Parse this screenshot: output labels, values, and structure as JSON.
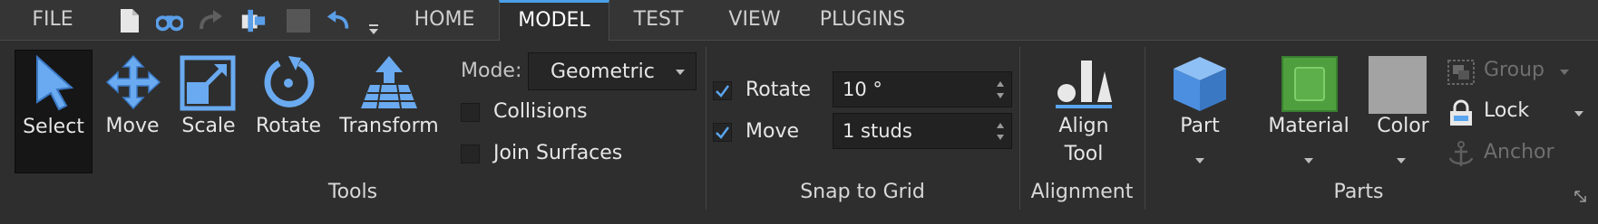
{
  "file_menu": "FILE",
  "tabs": [
    "HOME",
    "MODEL",
    "TEST",
    "VIEW",
    "PLUGINS"
  ],
  "active_tab": "MODEL",
  "accent_color": "#4a9fe6",
  "quick_access": [
    "new-document-icon",
    "find-binoculars-icon",
    "redo-icon",
    "publish-icon",
    "stop-icon",
    "undo-icon",
    "quick-access-dropdown-icon"
  ],
  "tools": {
    "label": "Tools",
    "buttons": [
      {
        "label": "Select",
        "icon": "select-arrow-icon",
        "selected": true
      },
      {
        "label": "Move",
        "icon": "move-arrows-icon",
        "selected": false
      },
      {
        "label": "Scale",
        "icon": "scale-icon",
        "selected": false
      },
      {
        "label": "Rotate",
        "icon": "rotate-icon",
        "selected": false
      },
      {
        "label": "Transform",
        "icon": "transform-icon",
        "selected": false
      }
    ],
    "mode_label": "Mode:",
    "mode_value": "Geometric",
    "collisions_label": "Collisions",
    "collisions_checked": false,
    "join_surfaces_label": "Join Surfaces",
    "join_surfaces_checked": false
  },
  "snap": {
    "label": "Snap to Grid",
    "rotate_label": "Rotate",
    "rotate_checked": true,
    "rotate_value": "10 °",
    "move_label": "Move",
    "move_checked": true,
    "move_value": "1 studs"
  },
  "alignment": {
    "label": "Alignment",
    "button_line1": "Align",
    "button_line2": "Tool"
  },
  "parts": {
    "label": "Parts",
    "part_label": "Part",
    "material_label": "Material",
    "color_label": "Color",
    "color_swatch": "#a3a3a3",
    "group_label": "Group",
    "lock_label": "Lock",
    "anchor_label": "Anchor"
  }
}
